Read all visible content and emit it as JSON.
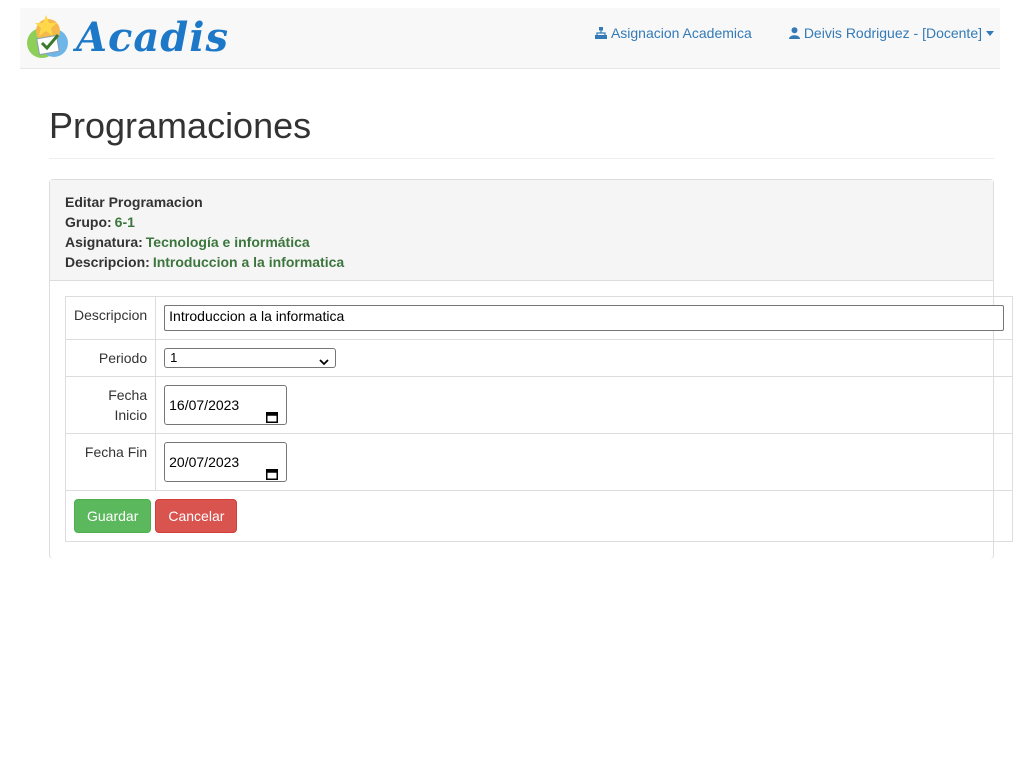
{
  "navbar": {
    "brand_text": "Acadis",
    "links": [
      {
        "label": "Asignacion Academica",
        "icon": "sitemap-icon"
      },
      {
        "label": "Deivis Rodriguez - [Docente]",
        "icon": "user-icon"
      }
    ]
  },
  "page": {
    "title": "Programaciones"
  },
  "panel": {
    "heading": "Editar Programacion",
    "grupo_label": "Grupo:",
    "grupo_value": "6-1",
    "asignatura_label": "Asignatura:",
    "asignatura_value": "Tecnología e informática",
    "descripcion_label": "Descripcion:",
    "descripcion_value": "Introduccion a la informatica"
  },
  "form": {
    "descripcion_label": "Descripcion",
    "descripcion_value": "Introduccion a la informatica",
    "periodo_label": "Periodo",
    "periodo_value": "1",
    "fecha_inicio_label_1": "Fecha",
    "fecha_inicio_label_2": "Inicio",
    "fecha_inicio_value": "16/07/2023",
    "fecha_fin_label": "Fecha Fin",
    "fecha_fin_value": "20/07/2023",
    "save_label": "Guardar",
    "cancel_label": "Cancelar"
  },
  "colors": {
    "link": "#337ab7",
    "success": "#5cb85c",
    "danger": "#d9534f",
    "value_green": "#3c763d"
  }
}
